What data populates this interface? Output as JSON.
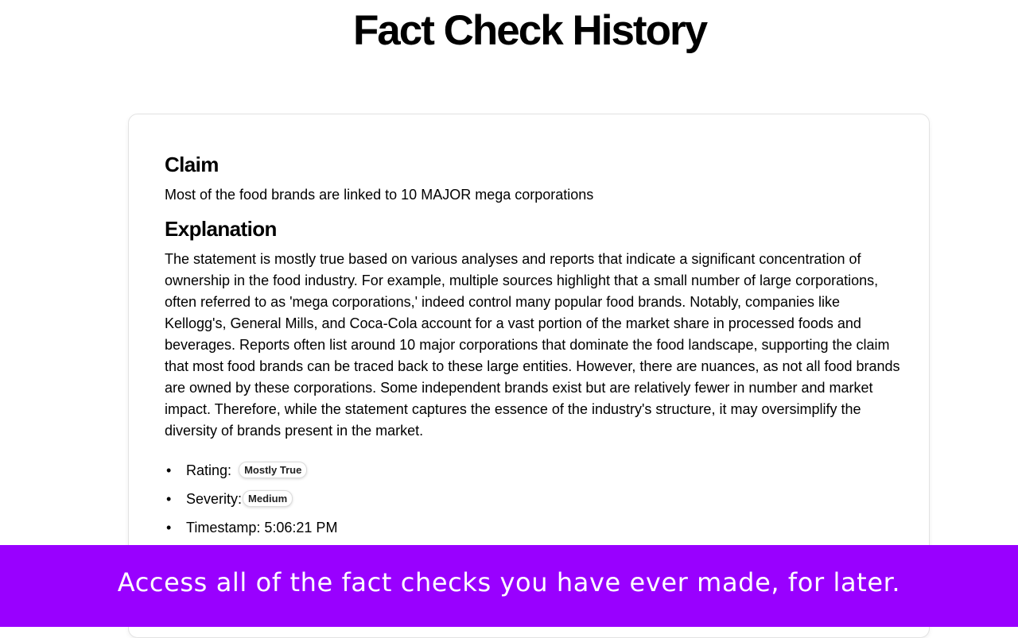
{
  "header": {
    "title": "Fact Check History"
  },
  "fact_check": {
    "claim_heading": "Claim",
    "claim_text": "Most of the food brands are linked to 10 MAJOR mega corporations",
    "explanation_heading": "Explanation",
    "explanation_text": "The statement is mostly true based on various analyses and reports that indicate a significant concentration of ownership in the food industry. For example, multiple sources highlight that a small number of large corporations, often referred to as 'mega corporations,' indeed control many popular food brands. Notably, companies like Kellogg's, General Mills, and Coca-Cola account for a vast portion of the market share in processed foods and beverages. Reports often list around 10 major corporations that dominate the food landscape, supporting the claim that most food brands can be traced back to these large entities. However, there are nuances, as not all food brands are owned by these corporations. Some independent brands exist but are relatively fewer in number and market impact. Therefore, while the statement captures the essence of the industry's structure, it may oversimplify the diversity of brands present in the market.",
    "rating_label": "Rating:",
    "rating_value": "Mostly True",
    "severity_label": "Severity:",
    "severity_value": "Medium",
    "timestamp_label": "Timestamp:",
    "timestamp_value": "5:06:21 PM",
    "bullet": "•"
  },
  "banner": {
    "text": "Access all of the fact checks you have ever made, for later.",
    "color": "#9900ff"
  }
}
